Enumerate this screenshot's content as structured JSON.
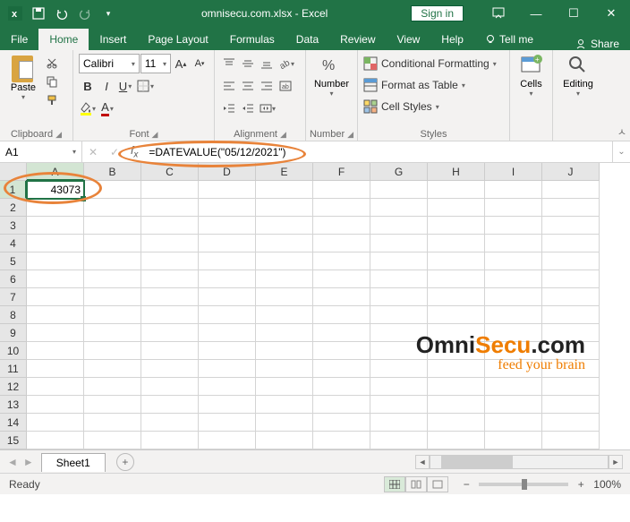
{
  "titlebar": {
    "document_title": "omnisecu.com.xlsx - Excel",
    "sign_in": "Sign in"
  },
  "tabs": {
    "file": "File",
    "home": "Home",
    "insert": "Insert",
    "page_layout": "Page Layout",
    "formulas": "Formulas",
    "data": "Data",
    "review": "Review",
    "view": "View",
    "help": "Help",
    "tell_me": "Tell me",
    "share": "Share"
  },
  "ribbon": {
    "clipboard": {
      "label": "Clipboard",
      "paste": "Paste"
    },
    "font": {
      "label": "Font",
      "name": "Calibri",
      "size": "11"
    },
    "alignment": {
      "label": "Alignment"
    },
    "number": {
      "label": "Number",
      "btn": "Number"
    },
    "styles": {
      "label": "Styles",
      "conditional": "Conditional Formatting",
      "table": "Format as Table",
      "cell": "Cell Styles"
    },
    "cells": {
      "label": "Cells"
    },
    "editing": {
      "label": "Editing"
    }
  },
  "namebox": {
    "ref": "A1"
  },
  "formula": {
    "text": "=DATEVALUE(\"05/12/2021\")"
  },
  "columns": [
    "A",
    "B",
    "C",
    "D",
    "E",
    "F",
    "G",
    "H",
    "I",
    "J"
  ],
  "rows": [
    "1",
    "2",
    "3",
    "4",
    "5",
    "6",
    "7",
    "8",
    "9",
    "10",
    "11",
    "12",
    "13",
    "14",
    "15"
  ],
  "cells": {
    "A1": "43073"
  },
  "sheet": {
    "name": "Sheet1"
  },
  "statusbar": {
    "ready": "Ready",
    "zoom": "100%"
  },
  "watermark": {
    "brand1": "Omni",
    "brand2": "Secu",
    "brand3": ".com",
    "tagline": "feed your brain"
  }
}
